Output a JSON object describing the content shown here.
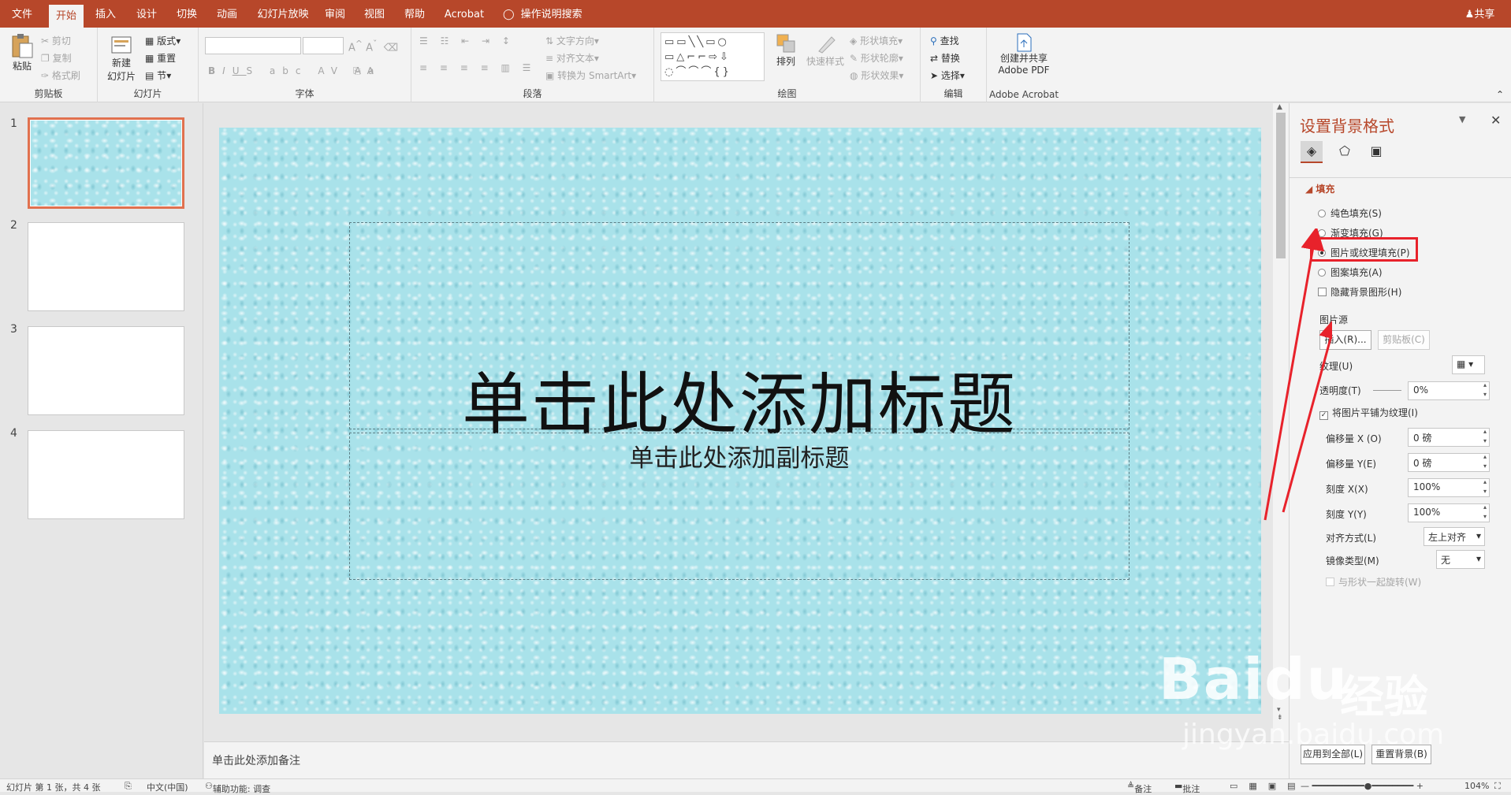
{
  "tabs": [
    "文件",
    "开始",
    "插入",
    "设计",
    "切换",
    "动画",
    "幻灯片放映",
    "审阅",
    "视图",
    "帮助",
    "Acrobat"
  ],
  "tell_me": "操作说明搜索",
  "share": "共享",
  "clipboard": {
    "paste": "粘贴",
    "cut": "剪切",
    "copy": "复制",
    "format_painter": "格式刷",
    "label": "剪贴板"
  },
  "slides_group": {
    "new_slide": "新建",
    "new_slide2": "幻灯片",
    "layout": "版式",
    "reset": "重置",
    "section": "节",
    "label": "幻灯片"
  },
  "font_group": {
    "label": "字体"
  },
  "paragraph_group": {
    "label": "段落",
    "text_direction": "文字方向",
    "align_text": "对齐文本",
    "smartart": "转换为 SmartArt"
  },
  "drawing_group": {
    "label": "绘图",
    "arrange": "排列",
    "quick_styles": "快速样式",
    "shape_fill": "形状填充",
    "shape_outline": "形状轮廓",
    "shape_effects": "形状效果"
  },
  "editing_group": {
    "label": "编辑",
    "find": "查找",
    "replace": "替换",
    "select": "选择"
  },
  "acrobat_group": {
    "line1": "创建并共享",
    "line2": "Adobe PDF",
    "label": "Adobe Acrobat"
  },
  "thumbnails": [
    "1",
    "2",
    "3",
    "4"
  ],
  "slide": {
    "title": "单击此处添加标题",
    "subtitle": "单击此处添加副标题"
  },
  "notes": "单击此处添加备注",
  "pane": {
    "title": "设置背景格式",
    "fill_section": "填充",
    "options": [
      "纯色填充(S)",
      "渐变填充(G)",
      "图片或纹理填充(P)",
      "图案填充(A)"
    ],
    "hide_bg": "隐藏背景图形(H)",
    "picture_source": "图片源",
    "insert": "插入(R)...",
    "clipboard": "剪贴板(C)",
    "texture": "纹理(U)",
    "transparency_label": "透明度(T)",
    "transparency_value": "0%",
    "tile": "将图片平铺为纹理(I)",
    "offset_x_label": "偏移量 X (O)",
    "offset_x": "0 磅",
    "offset_y_label": "偏移量 Y(E)",
    "offset_y": "0 磅",
    "scale_x_label": "刻度 X(X)",
    "scale_x": "100%",
    "scale_y_label": "刻度 Y(Y)",
    "scale_y": "100%",
    "align_label": "对齐方式(L)",
    "align_value": "左上对齐",
    "mirror_label": "镜像类型(M)",
    "mirror_value": "无",
    "rotate": "与形状一起旋转(W)",
    "apply_all": "应用到全部(L)",
    "reset_bg": "重置背景(B)"
  },
  "status": {
    "slide_info": "幻灯片 第 1 张，共 4 张",
    "language": "中文(中国)",
    "accessibility": "辅助功能: 调查",
    "notes": "备注",
    "comments": "批注",
    "zoom": "104%"
  },
  "watermark": {
    "brand": "Baidu",
    "cn": "经验",
    "url": "jingyan.baidu.com"
  },
  "colors": {
    "accent": "#b7472a",
    "highlight": "#e8222b",
    "slide_bg": "#a9e2ea"
  }
}
